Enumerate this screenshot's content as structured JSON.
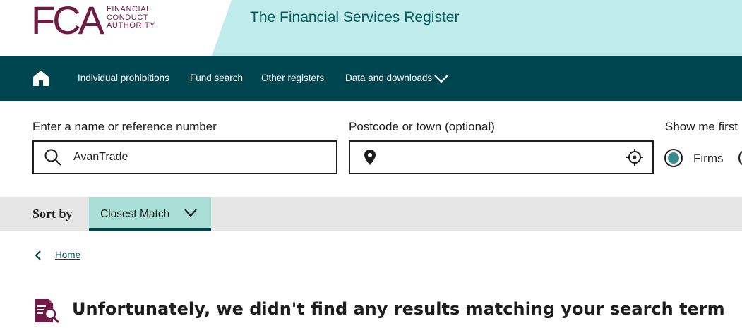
{
  "header": {
    "logo_mark": "FCA",
    "logo_lines": [
      "FINANCIAL",
      "CONDUCT",
      "AUTHORITY"
    ],
    "register_title": "The Financial Services Register"
  },
  "nav": {
    "home_icon": "home-icon",
    "items": [
      {
        "label": "Individual prohibitions"
      },
      {
        "label": "Fund search"
      },
      {
        "label": "Other registers"
      },
      {
        "label": "Data and downloads"
      }
    ]
  },
  "search": {
    "name_label": "Enter a name or reference number",
    "name_value": "AvanTrade",
    "postcode_label": "Postcode or town (optional)",
    "postcode_value": "",
    "show_me_label": "Show me first",
    "radio_options": [
      {
        "label": "Firms",
        "selected": true
      }
    ]
  },
  "sort": {
    "label": "Sort by",
    "selected": "Closest Match"
  },
  "breadcrumb": {
    "home_label": "Home"
  },
  "results": {
    "no_results_message": "Unfortunately, we didn't find any results matching your search term"
  },
  "colors": {
    "brand_magenta": "#701b45",
    "nav_teal": "#004650",
    "header_teal": "#bfecea",
    "sort_select": "#aadfd8"
  }
}
